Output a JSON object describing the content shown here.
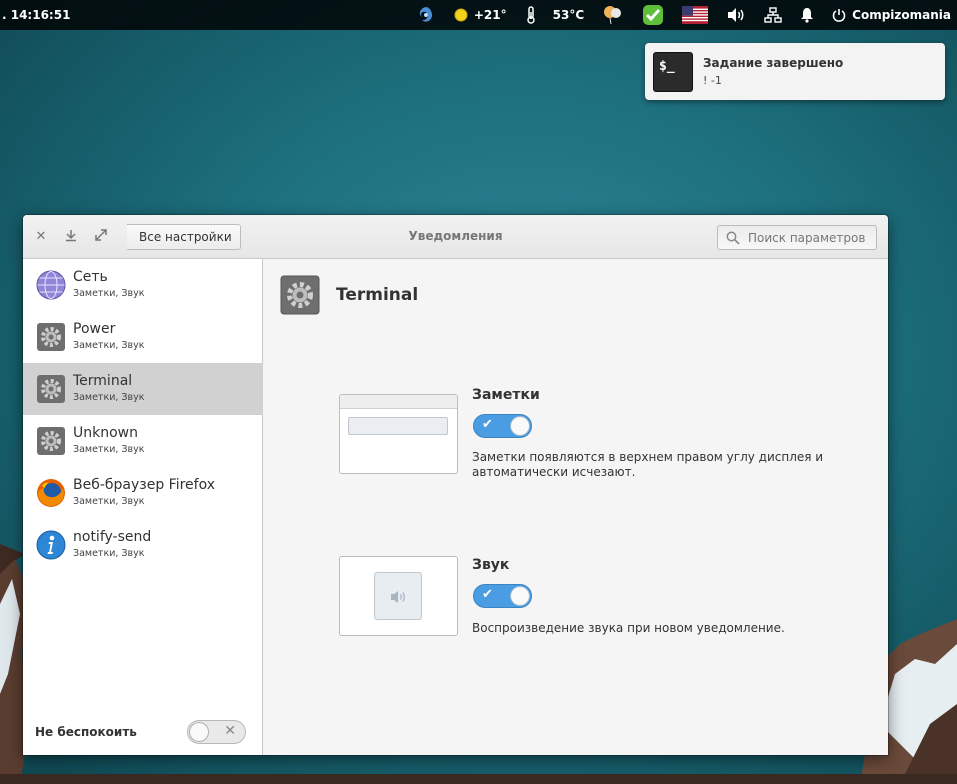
{
  "panel": {
    "clock": ". 14:16:51",
    "weather_temp": "+21°",
    "cpu_temp": "53°C",
    "user": "Compizomania"
  },
  "notification": {
    "icon_text": "$_",
    "title": "Задание завершено",
    "body": "! -1"
  },
  "window": {
    "back_label": "Все настройки",
    "title": "Уведомления",
    "search_placeholder": "Поиск параметров"
  },
  "sidebar": {
    "items": [
      {
        "name": "Сеть",
        "sub": "Заметки, Звук",
        "icon": "network-globe-icon"
      },
      {
        "name": "Power",
        "sub": "Заметки, Звук",
        "icon": "gear-icon"
      },
      {
        "name": "Terminal",
        "sub": "Заметки, Звук",
        "icon": "gear-icon"
      },
      {
        "name": "Unknown",
        "sub": "Заметки, Звук",
        "icon": "gear-icon"
      },
      {
        "name": "Веб-браузер Firefox",
        "sub": "Заметки, Звук",
        "icon": "firefox-icon"
      },
      {
        "name": "notify-send",
        "sub": "Заметки, Звук",
        "icon": "info-icon"
      }
    ],
    "selected_index": 2,
    "dnd_label": "Не беспокоить",
    "dnd_enabled": false
  },
  "main": {
    "app_name": "Terminal",
    "options": [
      {
        "title": "Заметки",
        "enabled": true,
        "desc": "Заметки появляются в верхнем правом углу дисплея и автоматически исчезают."
      },
      {
        "title": "Звук",
        "enabled": true,
        "desc": "Воспроизведение звука при новом уведомление."
      }
    ]
  },
  "colors": {
    "accent": "#4a9de2",
    "selection": "#d1d1d1",
    "panel": "#000000"
  }
}
